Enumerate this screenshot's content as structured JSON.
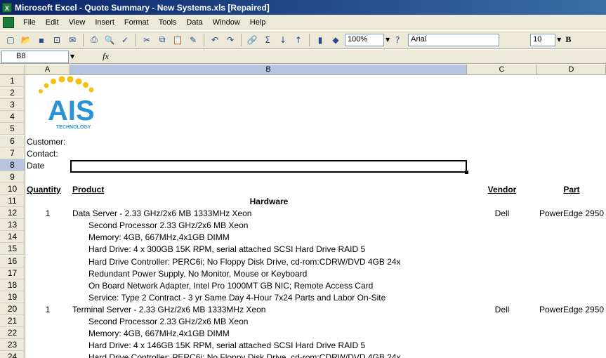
{
  "window": {
    "title": "Microsoft Excel - Quote Summary - New Systems.xls  [Repaired]"
  },
  "menu": [
    "File",
    "Edit",
    "View",
    "Insert",
    "Format",
    "Tools",
    "Data",
    "Window",
    "Help"
  ],
  "toolbar": {
    "zoom": "100%",
    "font": "Arial",
    "font_size": "10",
    "bold": "B"
  },
  "formula_bar": {
    "name_box": "B8",
    "fx": "fx"
  },
  "columns": [
    "A",
    "B",
    "C",
    "D"
  ],
  "logo": {
    "text": "AIS",
    "subtext": "TECHNOLOGY",
    "accent": "#2a93d5",
    "dots": "#f4c20d"
  },
  "rows": [
    {
      "n": "1"
    },
    {
      "n": "2"
    },
    {
      "n": "3"
    },
    {
      "n": "4"
    },
    {
      "n": "5"
    },
    {
      "n": "6",
      "a": "Customer:"
    },
    {
      "n": "7",
      "a": "Contact:"
    },
    {
      "n": "8",
      "a": "Date"
    },
    {
      "n": "9"
    },
    {
      "n": "10",
      "a": "Quantity",
      "b": "Product",
      "c": "Vendor",
      "d": "Part"
    },
    {
      "n": "11",
      "b": "Hardware"
    },
    {
      "n": "12",
      "a": "1",
      "b": "Data Server -  2.33 GHz/2x6 MB 1333MHz Xeon",
      "c": "Dell",
      "d": "PowerEdge 2950"
    },
    {
      "n": "13",
      "b": "Second Processor 2.33 GHz/2x6 MB Xeon"
    },
    {
      "n": "14",
      "b": "Memory: 4GB, 667MHz,4x1GB DIMM"
    },
    {
      "n": "15",
      "b": "Hard Drive: 4 x 300GB 15K RPM, serial attached SCSI Hard Drive RAID 5"
    },
    {
      "n": "16",
      "b": "Hard Drive Controller: PERC6i; No Floppy Disk Drive, cd-rom:CDRW/DVD 4GB 24x"
    },
    {
      "n": "17",
      "b": "Redundant Power Supply, No Monitor, Mouse or Keyboard"
    },
    {
      "n": "18",
      "b": "On Board Network Adapter, Intel Pro 1000MT GB NIC; Remote Access Card"
    },
    {
      "n": "19",
      "b": "Service: Type 2 Contract - 3 yr Same Day 4-Hour 7x24 Parts and Labor On-Site"
    },
    {
      "n": "20",
      "a": "1",
      "b": "Terminal Server -  2.33 GHz/2x6 MB 1333MHz Xeon",
      "c": "Dell",
      "d": "PowerEdge 2950"
    },
    {
      "n": "21",
      "b": "Second Processor 2.33 GHz/2x6 MB Xeon"
    },
    {
      "n": "22",
      "b": "Memory: 4GB, 667MHz,4x1GB DIMM"
    },
    {
      "n": "23",
      "b": "Hard Drive: 4 x 146GB 15K RPM, serial attached SCSI Hard Drive RAID 5"
    },
    {
      "n": "24",
      "b": "Hard Drive Controller: PERC6i; No Floppy Disk Drive, cd-rom:CDRW/DVD 4GB 24x"
    }
  ]
}
